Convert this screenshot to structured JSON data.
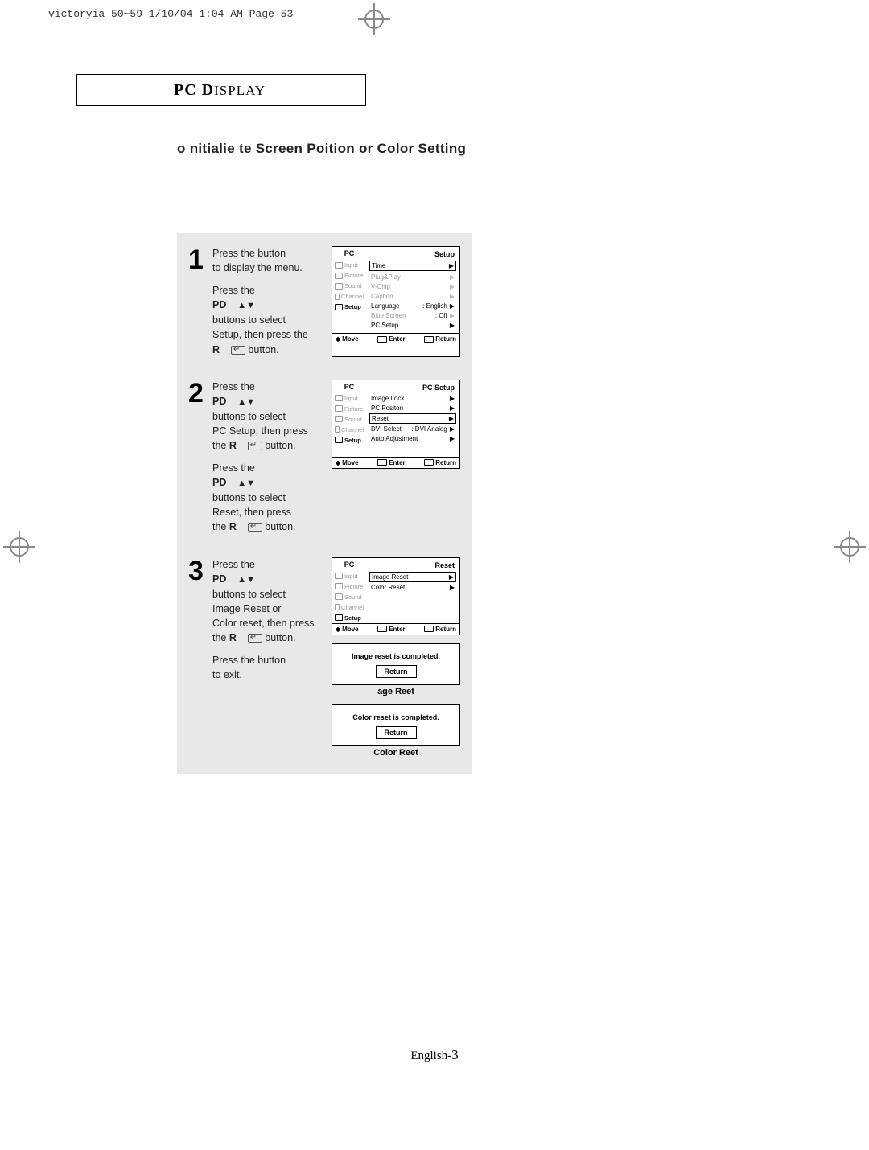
{
  "print_header": "victoryia 50~59  1/10/04 1:04 AM  Page 53",
  "title_box": {
    "pc": "PC",
    "disp": " D",
    "isplay": "ISPLAY"
  },
  "section_heading": "o nitialie te Screen Poition or Color Setting",
  "page_number_prefix": "English-",
  "page_number": "3",
  "osd_side": {
    "hdr": "PC",
    "items": [
      "Input",
      "Picture",
      "Sound",
      "Channel",
      "Setup"
    ]
  },
  "osd_foot": {
    "move": "Move",
    "enter": "Enter",
    "return": "Return"
  },
  "step1": {
    "num": "1",
    "l1": "Press the           button",
    "l2": "to display the menu.",
    "l3": "Press the",
    "pd": "PD",
    "l4": "buttons to select",
    "l5": "Setup, then press the",
    "r": "R",
    "l6": "button.",
    "osd_title": "Setup",
    "rows": [
      {
        "label": "Time",
        "boxed": true
      },
      {
        "label": "Plug&Play",
        "muted": true
      },
      {
        "label": "V-Chip",
        "muted": true
      },
      {
        "label": "Caption",
        "muted": true
      },
      {
        "label": "Language",
        "val": ":   English"
      },
      {
        "label": "Blue Screen",
        "val": ":   Off",
        "muted": true
      },
      {
        "label": "PC Setup"
      }
    ]
  },
  "step2": {
    "num": "2",
    "l1": "Press the",
    "pd": "PD",
    "l2": "buttons to select",
    "l3": "PC Setup, then press",
    "l4a": "the ",
    "r": "R",
    "l4b": " button.",
    "l5": "Press the",
    "l6": "buttons to select",
    "l7": "Reset, then press",
    "osd_title": "PC Setup",
    "rows": [
      {
        "label": "Image Lock"
      },
      {
        "label": "PC Positon"
      },
      {
        "label": "Reset",
        "boxed": true
      },
      {
        "label": "DVI Select",
        "val": ": DVI Analog"
      },
      {
        "label": "Auto Adjustment"
      }
    ]
  },
  "step3": {
    "num": "3",
    "l1": "Press the",
    "pd": "PD",
    "l2": "buttons to select",
    "l3": "Image Reset or",
    "l4": "Color reset, then press",
    "l5a": "the ",
    "r": "R",
    "l5b": " button.",
    "l6": "Press the           button",
    "l7": "to exit.",
    "osd_title": "Reset",
    "rows": [
      {
        "label": "Image Reset",
        "boxed": true
      },
      {
        "label": "Color Reset"
      }
    ],
    "msg1_text": "Image reset is completed.",
    "msg1_btn": "Return",
    "msg1_cap": "age Reet",
    "msg2_text": "Color reset is completed.",
    "msg2_btn": "Return",
    "msg2_cap": "Color Reet"
  }
}
